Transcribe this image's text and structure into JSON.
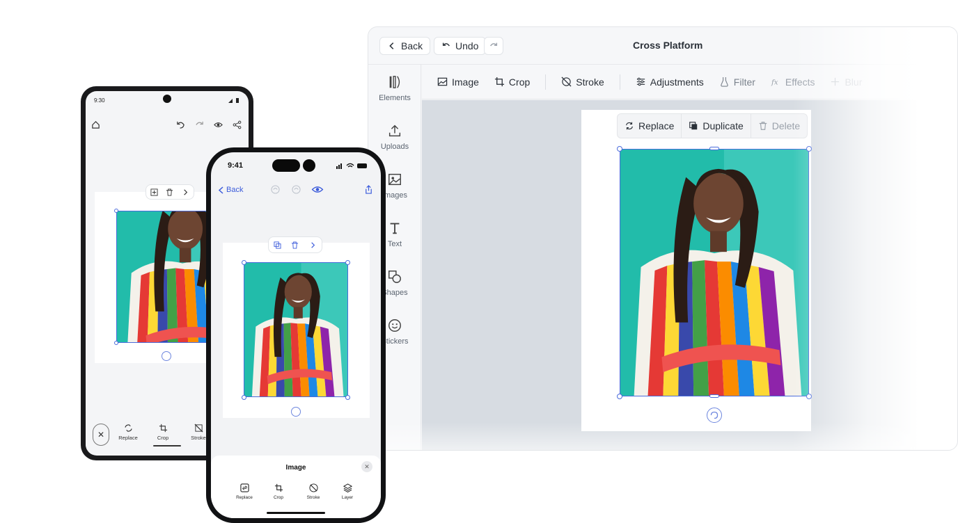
{
  "desktop": {
    "title": "Cross Platform",
    "back_label": "Back",
    "undo_label": "Undo",
    "sidebar": [
      {
        "label": "Elements",
        "icon": "elements-icon"
      },
      {
        "label": "Uploads",
        "icon": "upload-icon"
      },
      {
        "label": "Images",
        "icon": "image-icon"
      },
      {
        "label": "Text",
        "icon": "text-icon"
      },
      {
        "label": "Shapes",
        "icon": "shapes-icon"
      },
      {
        "label": "Stickers",
        "icon": "sticker-icon"
      }
    ],
    "toolbar": [
      {
        "label": "Image",
        "icon": "image-icon"
      },
      {
        "label": "Crop",
        "icon": "crop-icon"
      },
      {
        "label": "Stroke",
        "icon": "stroke-icon"
      },
      {
        "label": "Adjustments",
        "icon": "sliders-icon"
      },
      {
        "label": "Filter",
        "icon": "flask-icon"
      },
      {
        "label": "Effects",
        "icon": "fx-icon"
      },
      {
        "label": "Blur",
        "icon": "blur-icon"
      }
    ],
    "context_bar": [
      {
        "label": "Replace",
        "icon": "replace-icon"
      },
      {
        "label": "Duplicate",
        "icon": "duplicate-icon"
      },
      {
        "label": "Delete",
        "icon": "trash-icon"
      }
    ]
  },
  "android": {
    "time": "9:30",
    "bottom_tools": [
      {
        "label": "Replace",
        "icon": "replace-icon"
      },
      {
        "label": "Crop",
        "icon": "crop-icon"
      },
      {
        "label": "Stroke",
        "icon": "stroke-icon"
      }
    ]
  },
  "iphone": {
    "time": "9:41",
    "back_label": "Back",
    "sheet_title": "Image",
    "sheet_tools": [
      {
        "label": "Replace",
        "icon": "replace-icon"
      },
      {
        "label": "Crop",
        "icon": "crop-icon"
      },
      {
        "label": "Stroke",
        "icon": "stroke-icon"
      },
      {
        "label": "Layer",
        "icon": "layers-icon"
      }
    ]
  },
  "colors": {
    "accent": "#4a6bdc",
    "photo_background": "#1fb5a6",
    "canvas_background": "#d7dce2"
  }
}
